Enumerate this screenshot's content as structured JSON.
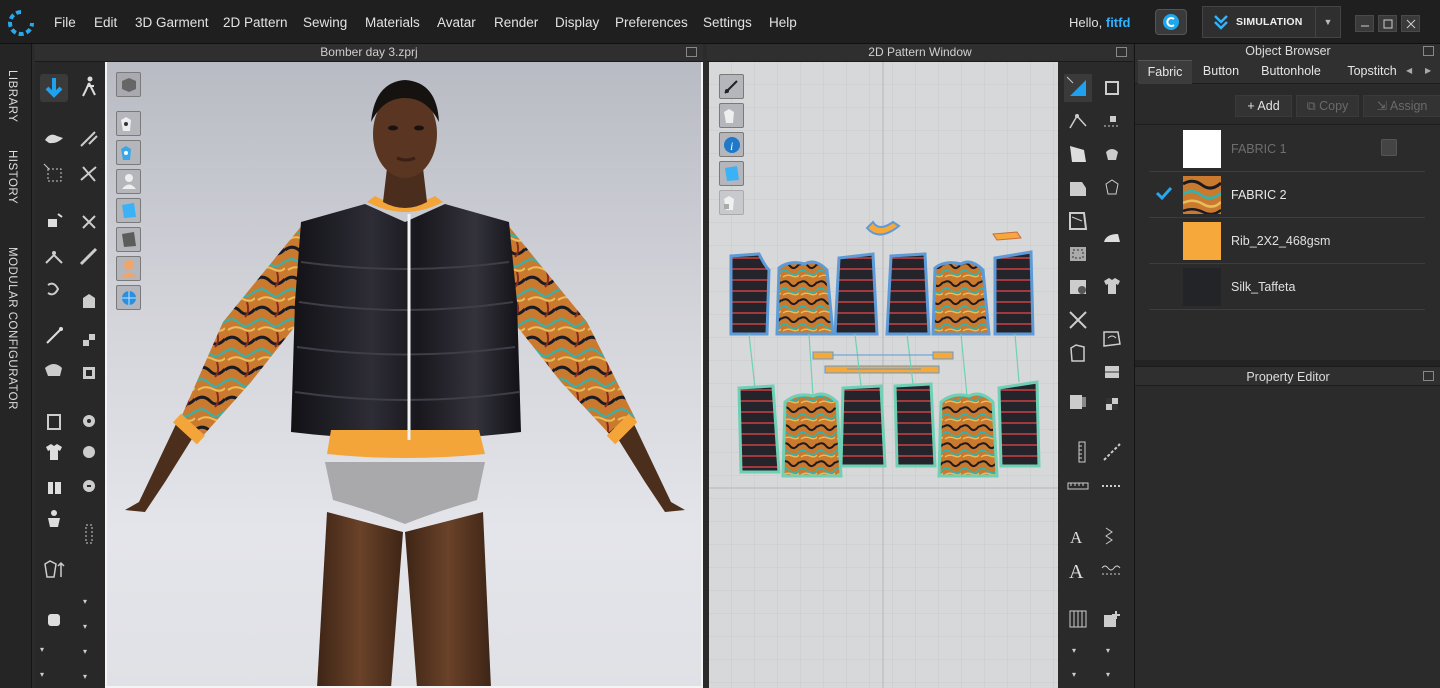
{
  "menubar": {
    "items": [
      "File",
      "Edit",
      "3D Garment",
      "2D Pattern",
      "Sewing",
      "Materials",
      "Avatar",
      "Render",
      "Display",
      "Preferences",
      "Settings",
      "Help"
    ],
    "greeting": "Hello, ",
    "username": "fitfd",
    "simulation_label": "SIMULATION"
  },
  "sidebar_tabs": [
    "LIBRARY",
    "HISTORY",
    "MODULAR CONFIGURATOR"
  ],
  "window3d": {
    "title": "Bomber day 3.zprj"
  },
  "window2d": {
    "title": "2D Pattern Window"
  },
  "object_browser": {
    "title": "Object Browser",
    "tabs": [
      "Fabric",
      "Button",
      "Buttonhole",
      "Topstitch"
    ],
    "active_tab": "Fabric",
    "actions": {
      "add": "Add",
      "copy": "Copy",
      "assign": "Assign"
    },
    "fabrics": [
      {
        "name": "FABRIC 1",
        "swatch": "#ffffff",
        "selected": false,
        "dimmed": true
      },
      {
        "name": "FABRIC 2",
        "swatch": "print-swirl",
        "selected": true,
        "dimmed": false
      },
      {
        "name": "Rib_2X2_468gsm",
        "swatch": "#f7a83a",
        "selected": false,
        "dimmed": false
      },
      {
        "name": "Silk_Taffeta",
        "swatch": "#232428",
        "selected": false,
        "dimmed": false
      }
    ]
  },
  "property_editor": {
    "title": "Property Editor"
  },
  "colors": {
    "accent_blue": "#2fb2ff",
    "rib_orange": "#f7a83a",
    "jacket_black": "#1d1c22",
    "menubar": "#1f1f1f",
    "panel": "#2b2b2b"
  }
}
